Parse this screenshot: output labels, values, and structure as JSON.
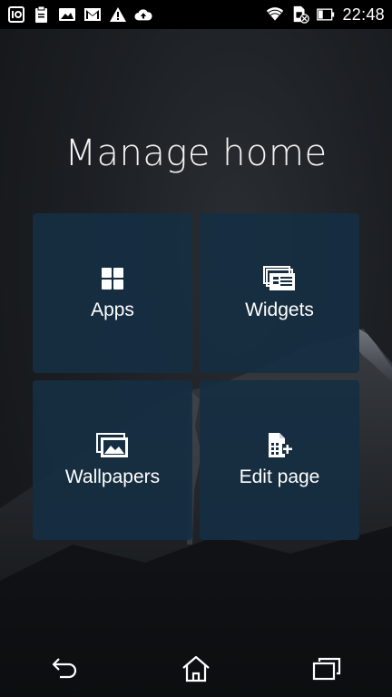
{
  "status_bar": {
    "left_icons": [
      "sim-toolkit-icon",
      "clipboard-icon",
      "image-notification-icon",
      "gmail-icon",
      "warning-icon",
      "cloud-upload-icon"
    ],
    "right_icons": [
      "wifi-icon",
      "no-sim-icon",
      "battery-icon"
    ],
    "time": "22:48",
    "battery_level": 0.35
  },
  "page": {
    "title": "Manage home"
  },
  "tiles": [
    {
      "label": "Apps",
      "icon": "apps-grid-icon"
    },
    {
      "label": "Widgets",
      "icon": "widgets-icon"
    },
    {
      "label": "Wallpapers",
      "icon": "wallpapers-icon"
    },
    {
      "label": "Edit page",
      "icon": "edit-page-icon"
    }
  ],
  "nav_bar": {
    "icons": [
      "back-icon",
      "home-icon",
      "recent-apps-icon"
    ]
  },
  "colors": {
    "tile_background": "#162e42",
    "status_bar_background": "#000000",
    "text": "#ffffff"
  }
}
